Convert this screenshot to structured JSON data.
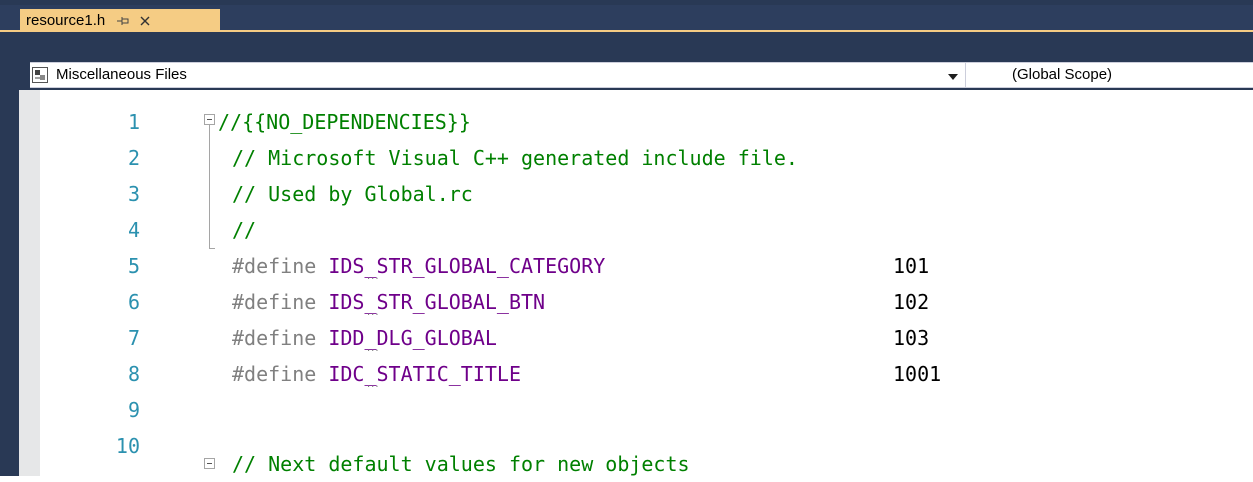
{
  "tab": {
    "title": "resource1.h",
    "pin_icon": "pin-icon",
    "close_icon": "close-icon"
  },
  "navbar": {
    "project": "Miscellaneous Files",
    "project_icon": "misc-files-icon",
    "scope": "(Global Scope)"
  },
  "editor": {
    "line_numbers": [
      "1",
      "2",
      "3",
      "4",
      "5",
      "6",
      "7",
      "8",
      "9",
      "10"
    ],
    "lines": [
      {
        "comment": "//{{NO_DEPENDENCIES}}"
      },
      {
        "comment": "// Microsoft Visual C++ generated include file."
      },
      {
        "comment": "// Used by Global.rc"
      },
      {
        "comment": "//"
      },
      {
        "directive": "#define",
        "macro": "IDS_STR_GLOBAL_CATEGORY",
        "value": "101"
      },
      {
        "directive": "#define",
        "macro": "IDS_STR_GLOBAL_BTN",
        "value": "102"
      },
      {
        "directive": "#define",
        "macro": "IDD_DLG_GLOBAL",
        "value": "103"
      },
      {
        "directive": "#define",
        "macro": "IDC_STATIC_TITLE",
        "value": "1001"
      },
      {
        "comment": ""
      },
      {
        "comment": "// Next default values for new objects"
      }
    ]
  },
  "colors": {
    "comment": "#008000",
    "line_number": "#2b91af",
    "macro": "#6f008a",
    "preprocessor": "#808080",
    "tab_active": "#f5cc84",
    "frame": "#293955"
  }
}
